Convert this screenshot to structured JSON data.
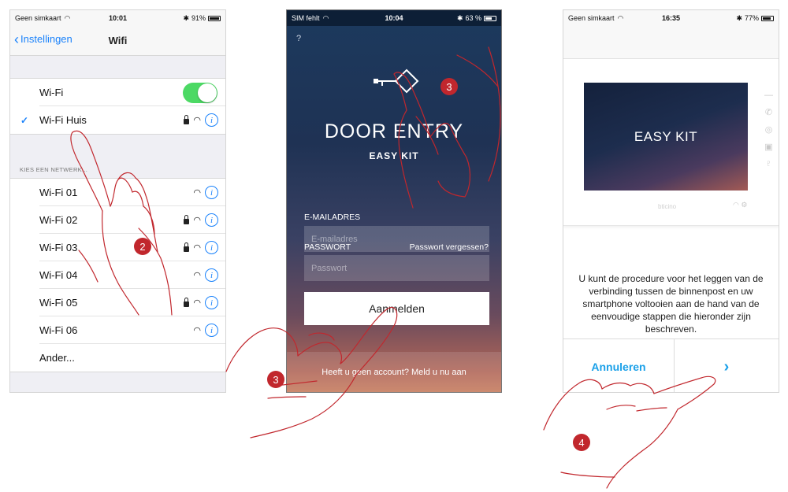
{
  "colors": {
    "accent_ios": "#1a82fb",
    "toggle_on": "#4cd964",
    "marker": "#c1272d",
    "app_accent": "#1aa0e8"
  },
  "panel1": {
    "status": {
      "carrier": "Geen simkaart",
      "time": "10:01",
      "battery": "91%"
    },
    "nav": {
      "back_label": "Instellingen",
      "title": "Wifi"
    },
    "wifi_toggle_label": "Wi-Fi",
    "connected_network": "Wi-Fi Huis",
    "section_header": "KIES EEN NETWERK...",
    "networks": [
      {
        "name": "Wi-Fi 01",
        "locked": false
      },
      {
        "name": "Wi-Fi 02",
        "locked": true
      },
      {
        "name": "Wi-Fi 03",
        "locked": true
      },
      {
        "name": "Wi-Fi 04",
        "locked": false
      },
      {
        "name": "Wi-Fi 05",
        "locked": true
      },
      {
        "name": "Wi-Fi 06",
        "locked": false
      }
    ],
    "other_label": "Ander..."
  },
  "panel2": {
    "status": {
      "carrier": "SIM fehlt",
      "time": "10:04",
      "battery": "63 %"
    },
    "help": "?",
    "title": "DOOR ENTRY",
    "subtitle": "EASY KIT",
    "email_label": "E-MAILADRES",
    "email_placeholder": "E-mailadres",
    "password_label": "PASSWORT",
    "forgot_label": "Passwort vergessen?",
    "password_placeholder": "Passwort",
    "login_button": "Aanmelden",
    "register_text": "Heeft u geen account? Meld u nu aan"
  },
  "panel3": {
    "status": {
      "carrier": "Geen simkaart",
      "time": "16:35",
      "battery": "77%"
    },
    "device_screen_text": "EASY KIT",
    "device_brand": "bticino",
    "description": "U kunt de procedure voor het leggen van de verbinding tussen de binnenpost en uw smartphone voltooien aan de hand van de eenvoudige stappen die hieronder zijn beschreven.",
    "cancel_button": "Annuleren",
    "next_button": "›"
  },
  "markers": {
    "m_panel1": "2",
    "m_panel2_logo": "3",
    "m_panel2_button": "3",
    "m_panel3": "4"
  }
}
